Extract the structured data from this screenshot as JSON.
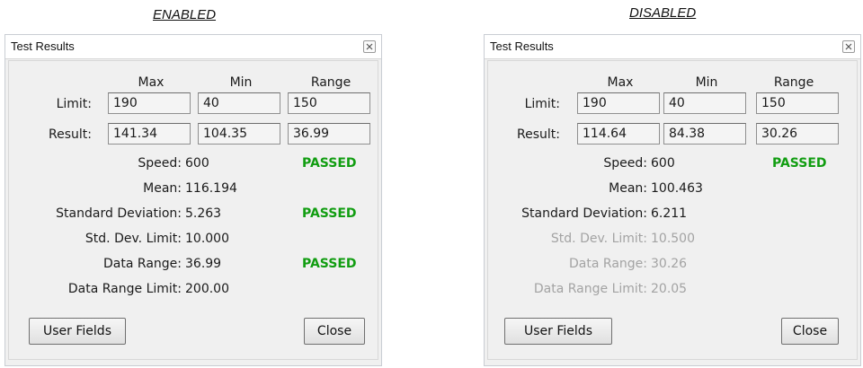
{
  "panels": [
    {
      "caption": "ENABLED",
      "title": "Test Results",
      "headers": [
        "Max",
        "Min",
        "Range"
      ],
      "limit_label": "Limit:",
      "result_label": "Result:",
      "limit": [
        "190",
        "40",
        "150"
      ],
      "result": [
        "141.34",
        "104.35",
        "36.99"
      ],
      "speed_label": "Speed:",
      "speed_value": "600",
      "speed_status": "PASSED",
      "mean_label": "Mean:",
      "mean_value": "116.194",
      "std_label": "Standard Deviation:",
      "std_value": "5.263",
      "std_status": "PASSED",
      "std_limit_label": "Std. Dev. Limit:",
      "std_limit_value": "10.000",
      "range_label": "Data Range:",
      "range_value": "36.99",
      "range_status": "PASSED",
      "range_limit_label": "Data Range Limit:",
      "range_limit_value": "200.00",
      "user_fields_label": "User Fields",
      "close_label": "Close"
    },
    {
      "caption": "DISABLED",
      "title": "Test Results",
      "headers": [
        "Max",
        "Min",
        "Range"
      ],
      "limit_label": "Limit:",
      "result_label": "Result:",
      "limit": [
        "190",
        "40",
        "150"
      ],
      "result": [
        "114.64",
        "84.38",
        "30.26"
      ],
      "speed_label": "Speed:",
      "speed_value": "600",
      "speed_status": "PASSED",
      "mean_label": "Mean:",
      "mean_value": "100.463",
      "std_label": "Standard Deviation:",
      "std_value": "6.211",
      "std_limit_label": "Std. Dev. Limit:",
      "std_limit_value": "10.500",
      "range_label": "Data Range:",
      "range_value": "30.26",
      "range_limit_label": "Data Range Limit:",
      "range_limit_value": "20.05",
      "user_fields_label": "User Fields",
      "close_label": "Close"
    }
  ],
  "colors": {
    "passed": "#119d11",
    "disabled_text": "#a3a3a3",
    "dialog_bg": "#f0f0f0"
  },
  "icons": {
    "window_close": "close-icon"
  }
}
